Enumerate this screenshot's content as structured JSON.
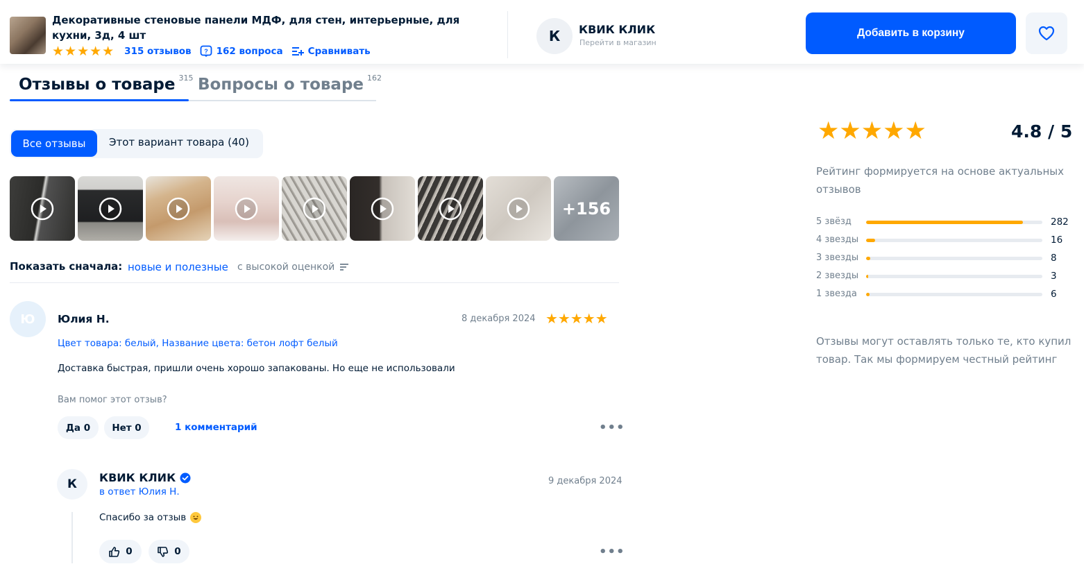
{
  "header": {
    "product_title": "Декоративные стеновые панели МДФ, для стен, интерьерные, для кухни, 3д, 4 шт",
    "stars": "★★★★★",
    "reviews_link": "315 отзывов",
    "questions_link": "162 вопроса",
    "compare_link": "Сравнивать",
    "seller_initial": "К",
    "seller_name": "КВИК КЛИК",
    "seller_sub": "Перейти в магазин",
    "cart_button": "Добавить в корзину"
  },
  "tabs": [
    {
      "label": "Отзывы о товаре",
      "count": "315"
    },
    {
      "label": "Вопросы о товаре",
      "count": "162"
    }
  ],
  "filter": {
    "all": "Все отзывы",
    "variant": "Этот вариант товара (40)"
  },
  "media": {
    "more": "+156"
  },
  "sort": {
    "label": "Показать сначала:",
    "option_active": "новые и полезные",
    "option_other": "с высокой оценкой"
  },
  "review": {
    "avatar_initial": "Ю",
    "author": "Юлия Н.",
    "date": "8 декабря 2024",
    "stars": "★★★★★",
    "variant": "Цвет товара: белый, Название цвета: бетон лофт белый",
    "text": "Доставка быстрая, пришли очень хорошо запакованы. Но еще не использовали",
    "helpful_question": "Вам помог этот отзыв?",
    "yes": "Да 0",
    "no": "Нет 0",
    "comments": "1 комментарий",
    "more": "•••"
  },
  "reply": {
    "avatar_initial": "К",
    "author": "КВИК КЛИК",
    "to": "в ответ Юлия Н.",
    "date": "9 декабря 2024",
    "text": "Спасибо за отзыв",
    "likes": "0",
    "dislikes": "0",
    "more": "•••"
  },
  "rating": {
    "stars": "★★★★★",
    "score": "4.8 / 5",
    "note": "Рейтинг формируется на основе актуальных отзывов",
    "footer_note": "Отзывы могут оставлять только те, кто купил товар. Так мы формируем честный рейтинг",
    "distribution": [
      {
        "label": "5 звёзд",
        "count": "282",
        "fraction": 0.89
      },
      {
        "label": "4 звезды",
        "count": "16",
        "fraction": 0.05
      },
      {
        "label": "3 звезды",
        "count": "8",
        "fraction": 0.025
      },
      {
        "label": "2 звезды",
        "count": "3",
        "fraction": 0.01
      },
      {
        "label": "1 звезда",
        "count": "6",
        "fraction": 0.02
      }
    ]
  },
  "colors": {
    "accent": "#005bff",
    "star": "#ffa800",
    "text": "#001a34",
    "muted": "#707f8d"
  }
}
